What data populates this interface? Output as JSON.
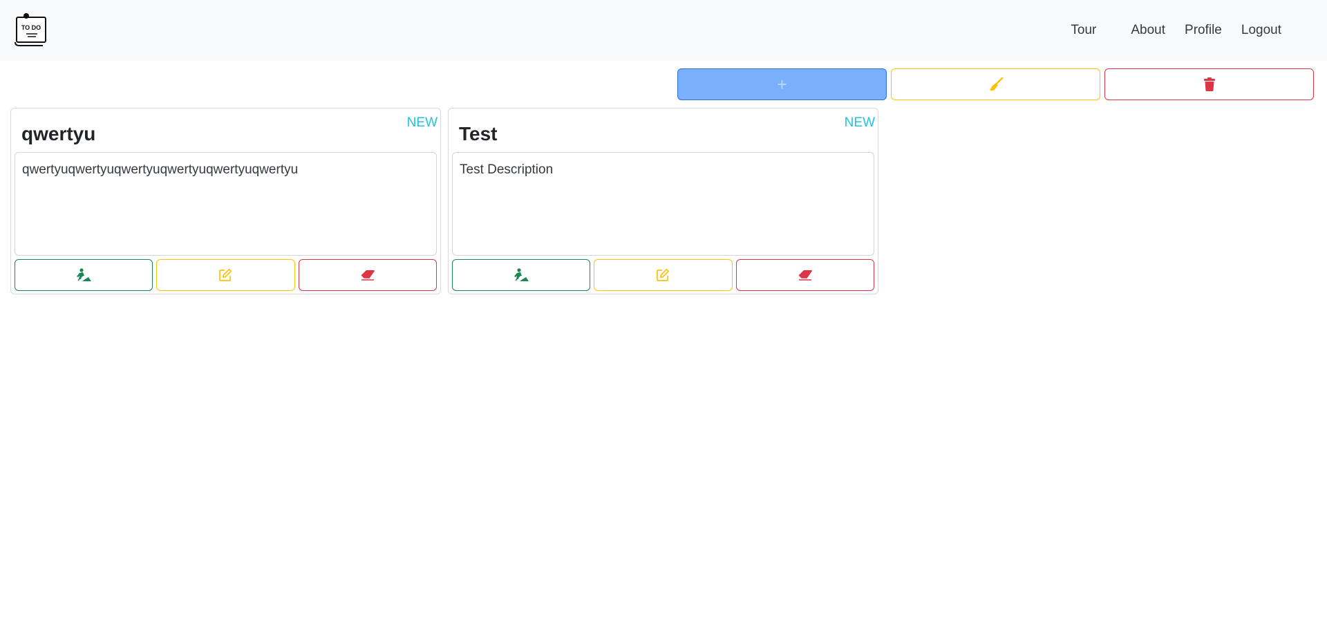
{
  "navbar": {
    "logo_text": "TO DO",
    "links": {
      "tour": "Tour",
      "about": "About",
      "profile": "Profile",
      "logout": "Logout"
    }
  },
  "toolbar": {
    "add_icon": "plus-icon",
    "clear_icon": "broom-icon",
    "delete_all_icon": "trash-icon"
  },
  "cards": [
    {
      "title": "qwertyu",
      "status": "NEW",
      "description": "qwertyuqwertyuqwertyuqwertyuqwertyuqwertyu"
    },
    {
      "title": "Test",
      "status": "NEW",
      "description": "Test Description"
    }
  ],
  "colors": {
    "primary": "#7ab0fb",
    "warning": "#ffc107",
    "danger": "#dc3545",
    "success": "#198754",
    "info": "#20c3dd"
  }
}
